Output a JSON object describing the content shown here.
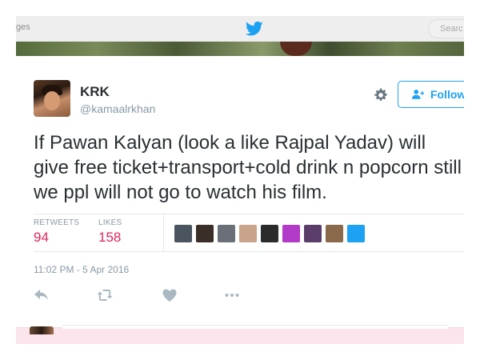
{
  "topbar": {
    "nav_fragment": "ges",
    "search_placeholder": "Searc"
  },
  "tweet": {
    "author_name": "KRK",
    "author_handle": "@kamaalrkhan",
    "follow_label": "Follow",
    "text": "If Pawan Kalyan (look a like Rajpal Yadav) will give free ticket+transport+cold drink n popcorn still we ppl will not go to watch his film.",
    "retweets_label": "RETWEETS",
    "retweets_count": "94",
    "likes_label": "LIKES",
    "likes_count": "158",
    "timestamp": "11:02 PM - 5 Apr 2016"
  },
  "likers": [
    {
      "icon": "liker-avatar-1",
      "color": "#4a5560"
    },
    {
      "icon": "liker-avatar-2",
      "color": "#3a2e28"
    },
    {
      "icon": "liker-avatar-3",
      "color": "#6b7078"
    },
    {
      "icon": "liker-avatar-4",
      "color": "#c9a48a"
    },
    {
      "icon": "liker-avatar-5",
      "color": "#2b2b2b"
    },
    {
      "icon": "liker-avatar-6",
      "color": "#b23ac8"
    },
    {
      "icon": "liker-avatar-7",
      "color": "#5a3d6b"
    },
    {
      "icon": "liker-avatar-8",
      "color": "#8a6a4a"
    },
    {
      "icon": "liker-avatar-9",
      "color": "#1da1f2"
    }
  ],
  "icons": [
    "twitter-bird-icon",
    "gear-icon",
    "follow-person-icon",
    "reply-icon",
    "retweet-icon",
    "like-heart-icon",
    "more-icon"
  ],
  "colors": {
    "accent": "#1da1f2",
    "like": "#e0245e",
    "text": "#292f33",
    "muted": "#8899a6"
  }
}
